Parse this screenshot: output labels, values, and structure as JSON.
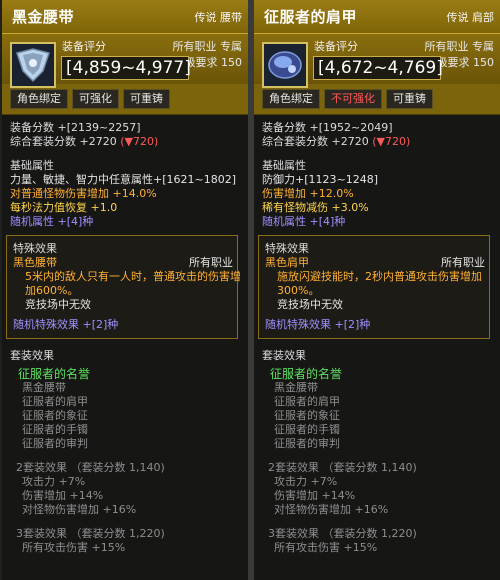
{
  "panels": [
    {
      "name": "黑金腰带",
      "tag": "传说 腰带",
      "rating_label": "装备评分",
      "rating": "[4,859~4,977]",
      "job": "所有职业 专属",
      "level": "等级要求 150",
      "buttons": [
        {
          "label": "角色绑定",
          "disabled": false
        },
        {
          "label": "可强化",
          "disabled": false
        },
        {
          "label": "可重铸",
          "disabled": false
        }
      ],
      "score": "装备分数 +[2139~2257]",
      "set_score": "综合套装分数 +2720",
      "set_score_delta": "(▼720)",
      "base_title": "基础属性",
      "base_lines": [
        {
          "text": "力量、敏捷、智力中任意属性+[1621~1802]",
          "color": "white"
        },
        {
          "text": "对普通怪物伤害增加 +14.0%",
          "color": "orange"
        },
        {
          "text": "每秒法力值恢复 +1.0",
          "color": "yellow"
        },
        {
          "text": "随机属性 +[4]种",
          "color": "blue"
        }
      ],
      "special_title": "特殊效果",
      "special_name": "黑色腰带",
      "special_job": "所有职业",
      "special_lines": [
        "5米内的敌人只有一人时，普通攻击的伤害增",
        "加600%。",
        "竞技场中无效"
      ],
      "special_random": "随机特殊效果 +[2]种",
      "set_title": "套装效果",
      "set_name": "征服者的名誉",
      "set_items": [
        "黑金腰带",
        "征服者的肩甲",
        "征服者的象征",
        "征服者的手镯",
        "征服者的审判"
      ],
      "set2_title": "2套装效果 （套装分数 1,140)",
      "set2_lines": [
        "攻击力 +7%",
        "伤害增加 +14%",
        "对怪物伤害增加 +16%"
      ],
      "set3_title": "3套装效果 （套装分数 1,220)",
      "set3_line": "所有攻击伤害 +15%"
    },
    {
      "name": "征服者的肩甲",
      "tag": "传说 肩部",
      "rating_label": "装备评分",
      "rating": "[4,672~4,769]",
      "job": "所有职业 专属",
      "level": "等级要求 150",
      "buttons": [
        {
          "label": "角色绑定",
          "disabled": false
        },
        {
          "label": "不可强化",
          "disabled": true
        },
        {
          "label": "可重铸",
          "disabled": false
        }
      ],
      "score": "装备分数 +[1952~2049]",
      "set_score": "综合套装分数 +2720",
      "set_score_delta": "(▼720)",
      "base_title": "基础属性",
      "base_lines": [
        {
          "text": "防御力+[1123~1248]",
          "color": "white"
        },
        {
          "text": "伤害增加 +12.0%",
          "color": "orange"
        },
        {
          "text": "稀有怪物减伤 +3.0%",
          "color": "yellow"
        },
        {
          "text": "随机属性 +[4]种",
          "color": "blue"
        }
      ],
      "special_title": "特殊效果",
      "special_name": "黑色肩甲",
      "special_job": "所有职业",
      "special_lines": [
        "施放闪避技能时，2秒内普通攻击伤害增加",
        "300%。",
        "竞技场中无效"
      ],
      "special_random": "随机特殊效果 +[2]种",
      "set_title": "套装效果",
      "set_name": "征服者的名誉",
      "set_items": [
        "黑金腰带",
        "征服者的肩甲",
        "征服者的象征",
        "征服者的手镯",
        "征服者的审判"
      ],
      "set2_title": "2套装效果 （套装分数 1,140)",
      "set2_lines": [
        "攻击力 +7%",
        "伤害增加 +14%",
        "对怪物伤害增加 +16%"
      ],
      "set3_title": "3套装效果 （套装分数 1,220)",
      "set3_line": "所有攻击伤害 +15%"
    }
  ]
}
